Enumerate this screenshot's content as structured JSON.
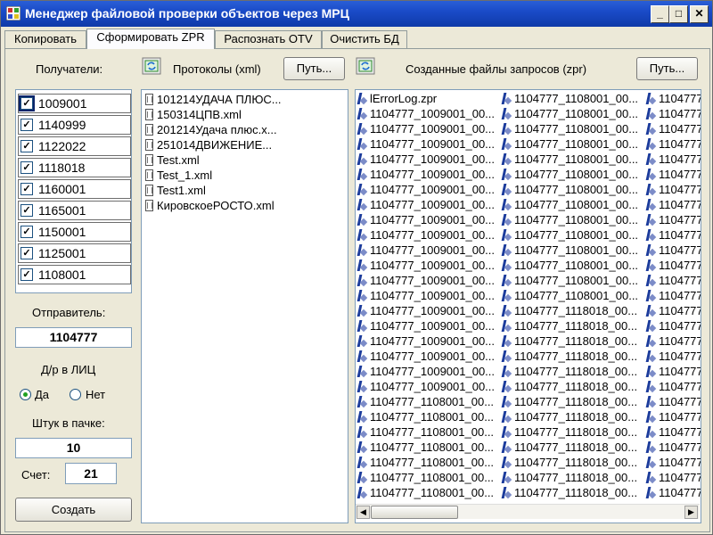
{
  "window": {
    "title": "Менеджер файловой проверки объектов через МРЦ",
    "minimize": "_",
    "maximize": "□",
    "close": "✕"
  },
  "tabs": [
    {
      "label": "Копировать"
    },
    {
      "label": "Сформировать ZPR"
    },
    {
      "label": "Распознать OTV"
    },
    {
      "label": "Очистить БД"
    }
  ],
  "recipients": {
    "label": "Получатели:",
    "items": [
      {
        "code": "1009001",
        "checked": "✓"
      },
      {
        "code": "1140999",
        "checked": "✓"
      },
      {
        "code": "1122022",
        "checked": "✓"
      },
      {
        "code": "1118018",
        "checked": "✓"
      },
      {
        "code": "1160001",
        "checked": "✓"
      },
      {
        "code": "1165001",
        "checked": "✓"
      },
      {
        "code": "1150001",
        "checked": "✓"
      },
      {
        "code": "1125001",
        "checked": "✓"
      },
      {
        "code": "1108001",
        "checked": "✓"
      }
    ]
  },
  "sender": {
    "label": "Отправитель:",
    "value": "1104777"
  },
  "dr_lic": {
    "label": "Д/р в ЛИЦ",
    "yes": "Да",
    "no": "Нет",
    "selected": "Да"
  },
  "batch": {
    "label": "Штук в пачке:",
    "value": "10"
  },
  "count": {
    "label": "Счет:",
    "value": "21"
  },
  "create_button": "Создать",
  "protocols": {
    "label": "Протоколы (xml)",
    "path_button": "Путь...",
    "files": [
      "101214УДАЧА ПЛЮС...",
      "150314ЦПВ.xml",
      "201214Удача плюс.x...",
      "251014ДВИЖЕНИЕ...",
      "Test.xml",
      "Test_1.xml",
      "Test1.xml",
      "КировскоеРОСТО.xml"
    ]
  },
  "requests": {
    "label": "Созданные файлы запросов (zpr)",
    "path_button": "Путь...",
    "col1": [
      "lErrorLog.zpr",
      "1104777_1009001_00...",
      "1104777_1009001_00...",
      "1104777_1009001_00...",
      "1104777_1009001_00...",
      "1104777_1009001_00...",
      "1104777_1009001_00...",
      "1104777_1009001_00...",
      "1104777_1009001_00...",
      "1104777_1009001_00...",
      "1104777_1009001_00...",
      "1104777_1009001_00...",
      "1104777_1009001_00...",
      "1104777_1009001_00...",
      "1104777_1009001_00...",
      "1104777_1009001_00...",
      "1104777_1009001_00...",
      "1104777_1009001_00...",
      "1104777_1009001_00...",
      "1104777_1009001_00...",
      "1104777_1108001_00...",
      "1104777_1108001_00...",
      "1104777_1108001_00...",
      "1104777_1108001_00...",
      "1104777_1108001_00...",
      "1104777_1108001_00...",
      "1104777_1108001_00..."
    ],
    "col2": [
      "1104777_1108001_00...",
      "1104777_1108001_00...",
      "1104777_1108001_00...",
      "1104777_1108001_00...",
      "1104777_1108001_00...",
      "1104777_1108001_00...",
      "1104777_1108001_00...",
      "1104777_1108001_00...",
      "1104777_1108001_00...",
      "1104777_1108001_00...",
      "1104777_1108001_00...",
      "1104777_1108001_00...",
      "1104777_1108001_00...",
      "1104777_1108001_00...",
      "1104777_1118018_00...",
      "1104777_1118018_00...",
      "1104777_1118018_00...",
      "1104777_1118018_00...",
      "1104777_1118018_00...",
      "1104777_1118018_00...",
      "1104777_1118018_00...",
      "1104777_1118018_00...",
      "1104777_1118018_00...",
      "1104777_1118018_00...",
      "1104777_1118018_00...",
      "1104777_1118018_00...",
      "1104777_1118018_00..."
    ],
    "col3": [
      "1104777",
      "1104777",
      "1104777",
      "1104777",
      "1104777",
      "1104777",
      "1104777",
      "1104777",
      "1104777",
      "1104777",
      "1104777",
      "1104777",
      "1104777",
      "1104777",
      "1104777",
      "1104777",
      "1104777",
      "1104777",
      "1104777",
      "1104777",
      "1104777",
      "1104777",
      "1104777",
      "1104777",
      "1104777",
      "1104777",
      "1104777"
    ],
    "scroll_left": "◀",
    "scroll_right": "▶"
  }
}
